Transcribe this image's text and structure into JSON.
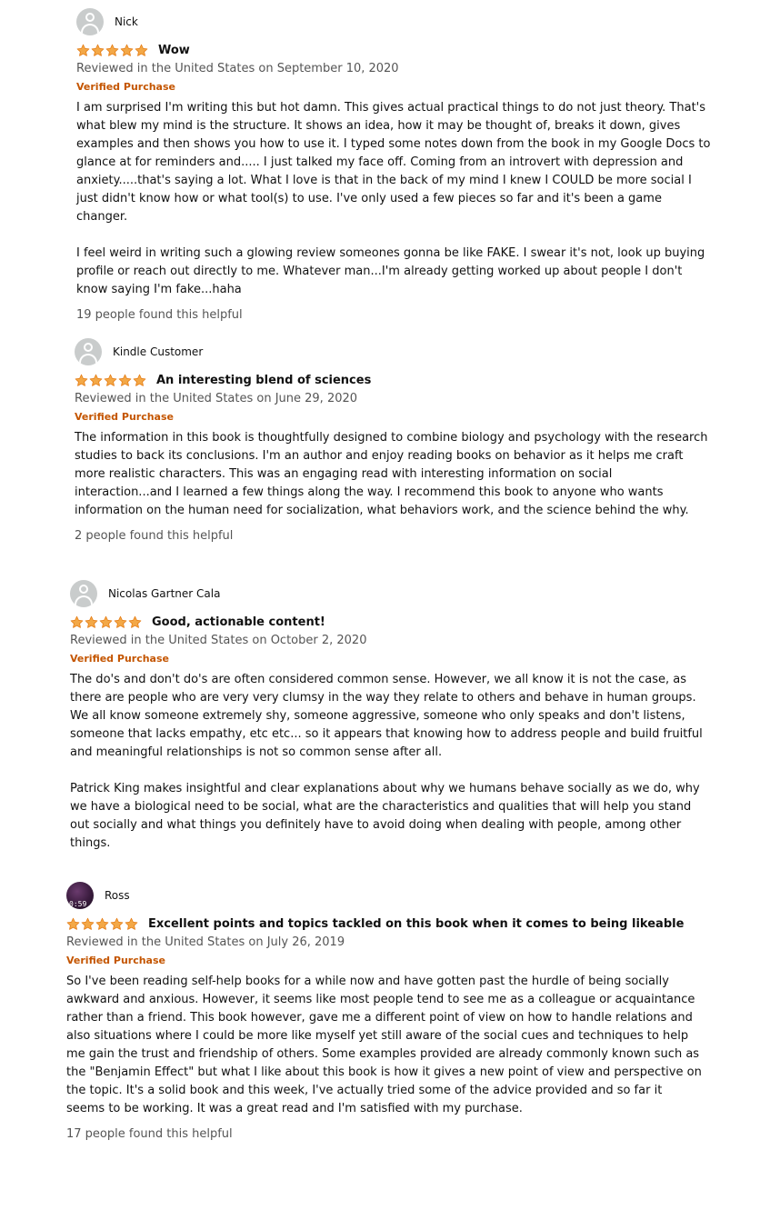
{
  "reviews": [
    {
      "author": "Nick",
      "rating": 5,
      "title": "Wow",
      "date": "Reviewed in the United States on September 10, 2020",
      "verified": "Verified Purchase",
      "paragraphs": [
        "I am surprised I'm writing this but hot damn. This gives actual practical things to do not just theory. That's what blew my mind is the structure. It shows an idea, how it may be thought of, breaks it down, gives examples and then shows you how to use it. I typed some notes down from the book in my Google Docs to glance at for reminders and..... I just talked my face off. Coming from an introvert with depression and anxiety.....that's saying a lot. What I love is that in the back of my mind I knew I COULD be more social I just didn't know how or what tool(s) to use. I've only used a few pieces so far and it's been a game changer.",
        "I feel weird in writing such a glowing review someones gonna be like FAKE. I swear it's not, look up buying profile or reach out directly to me. Whatever man...I'm already getting worked up about people I don't know saying I'm fake...haha"
      ],
      "helpful": "19 people found this helpful"
    },
    {
      "author": "Kindle Customer",
      "rating": 5,
      "title": "An interesting blend of sciences",
      "date": "Reviewed in the United States on June 29, 2020",
      "verified": "Verified Purchase",
      "paragraphs": [
        "The information in this book is thoughtfully designed to combine biology and psychology with the research studies to back its conclusions. I'm an author and enjoy reading books on behavior as it helps me craft more realistic characters. This was an engaging read with interesting information on social interaction...and I learned a few things along the way. I recommend this book to anyone who wants information on the human need for socialization, what behaviors work, and the science behind the why."
      ],
      "helpful": "2 people found this helpful"
    },
    {
      "author": "Nicolas Gartner Cala",
      "rating": 5,
      "title": "Good, actionable content!",
      "date": "Reviewed in the United States on October 2, 2020",
      "verified": "Verified Purchase",
      "paragraphs": [
        "The do's and don't do's are often considered common sense. However, we all know it is not the case, as there are people who are very very clumsy in the way they relate to others and behave in human groups. We all know someone extremely shy, someone aggressive, someone who only speaks and don't listens, someone that lacks empathy, etc etc... so it appears that knowing how to address people and build fruitful and meaningful relationships is not so common sense after all.",
        "Patrick King makes insightful and clear explanations about why we humans behave socially as we do, why we have a biological need to be social, what are the characteristics and qualities that will help you stand out socially and what things you definitely have to avoid doing when dealing with people, among other things."
      ],
      "helpful": ""
    },
    {
      "author": "Ross",
      "avatar_text": "0:59",
      "rating": 5,
      "title": "Excellent points and topics tackled on this book when it comes to being likeable",
      "date": "Reviewed in the United States on July 26, 2019",
      "verified": "Verified Purchase",
      "paragraphs": [
        "So I've been reading self-help books for a while now and have gotten past the hurdle of being socially awkward and anxious. However, it seems like most people tend to see me as a colleague or acquaintance rather than a friend. This book however, gave me a different point of view on how to handle relations and also situations where I could be more like myself yet still aware of the social cues and techniques to help me gain the trust and friendship of others. Some examples provided are already commonly known such as the \"Benjamin Effect\" but what I like about this book is how it gives a new point of view and perspective on the topic. It's a solid book and this week, I've actually tried some of the advice provided and so far it seems to be working. It was a great read and I'm satisfied with my purchase."
      ],
      "helpful": "17 people found this helpful"
    }
  ],
  "colors": {
    "star": "#f3a847",
    "star_stroke": "#e47911",
    "verified": "#c45500",
    "meta": "#555555"
  },
  "icons": {
    "avatar_default": "default-user-avatar-icon",
    "star": "star-icon"
  }
}
